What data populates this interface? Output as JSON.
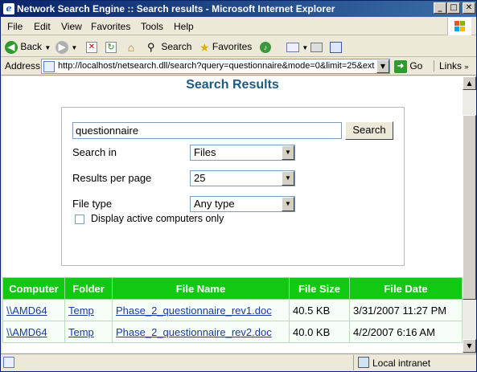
{
  "window": {
    "title": "Network Search Engine :: Search results - Microsoft Internet Explorer"
  },
  "menu": {
    "items": [
      "File",
      "Edit",
      "View",
      "Favorites",
      "Tools",
      "Help"
    ]
  },
  "toolbar": {
    "back": "Back",
    "search": "Search",
    "favorites": "Favorites"
  },
  "address": {
    "label": "Address",
    "url": "http://localhost/netsearch.dll/search?query=questionnaire&mode=0&limit=25&ext",
    "go": "Go",
    "links": "Links"
  },
  "page": {
    "heading": "Search Results",
    "form": {
      "query": "questionnaire",
      "search_button": "Search",
      "search_in_label": "Search in",
      "search_in_value": "Files",
      "results_label": "Results per page",
      "results_value": "25",
      "filetype_label": "File type",
      "filetype_value": "Any type",
      "active_only_label": "Display active computers only",
      "active_only_checked": false
    },
    "table": {
      "headers": [
        "Computer",
        "Folder",
        "File Name",
        "File Size",
        "File Date"
      ],
      "rows": [
        [
          "\\\\AMD64",
          "Temp",
          "Phase_2_questionnaire_rev1.doc",
          "40.5 KB",
          "3/31/2007 11:27 PM"
        ],
        [
          "\\\\AMD64",
          "Temp",
          "Phase_2_questionnaire_rev2.doc",
          "40.0 KB",
          "4/2/2007 6:16 AM"
        ]
      ]
    }
  },
  "status": {
    "zone": "Local intranet"
  },
  "colors": {
    "table_header": "#13c813",
    "heading": "#1e5a82",
    "titlebar": "#0a246a"
  }
}
